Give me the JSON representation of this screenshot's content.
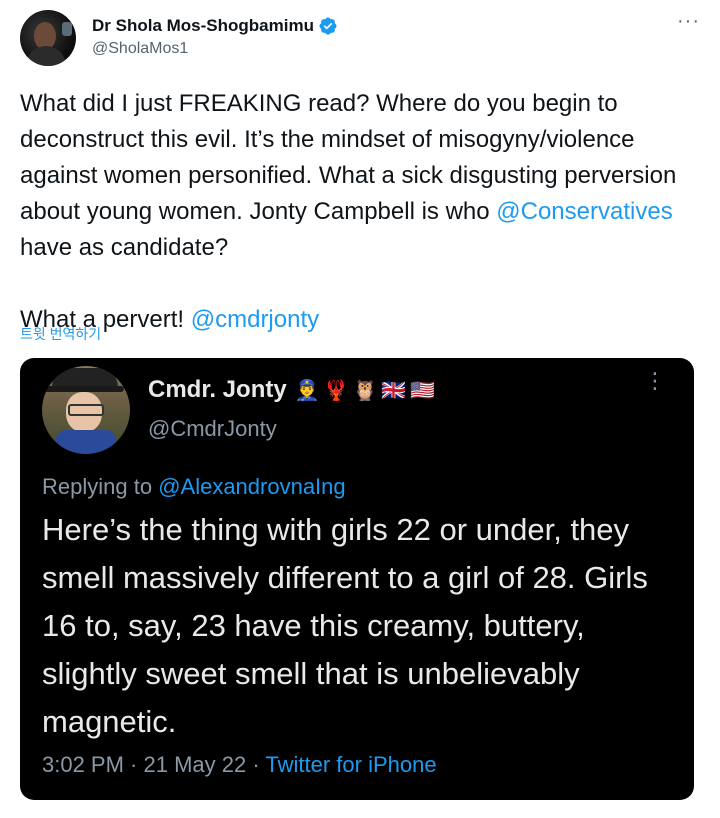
{
  "author": {
    "display_name": "Dr Shola Mos-Shogbamimu",
    "handle": "@SholaMos1"
  },
  "icons": {
    "verified": "verified-badge-icon",
    "more": "more-options-icon"
  },
  "colors": {
    "accent": "#1d9bf0",
    "text": "#0f1419",
    "muted": "#536471",
    "quote_bg": "#000000"
  },
  "tweet": {
    "line1": "What did I just FREAKING read? Where do you begin to deconstruct this evil. It’s the mindset of misogyny/violence against women personified. What a sick disgusting perversion about young women. Jonty Campbell is who ",
    "mention1": "@Conservatives",
    "line2": " have as candidate?\n\nWhat a pervert! ",
    "mention2": "@cmdrjonty"
  },
  "translate_label": "트윗 번역하기",
  "quoted_tweet": {
    "display_name": "Cmdr. Jonty",
    "emojis": "👮‍♂️🦞🦉🇬🇧🇺🇸",
    "handle": "@CmdrJonty",
    "replying_label": "Replying to ",
    "replying_to": "@AlexandrovnaIng",
    "body": "Here’s the thing with girls 22 or under, they smell massively different to a girl of 28. Girls 16 to, say, 23 have this creamy, buttery,  slightly sweet smell that is unbelievably magnetic.",
    "time": "3:02 PM",
    "sep": " · ",
    "date": "21 May 22",
    "sep2": " · ",
    "source": "Twitter for iPhone"
  }
}
